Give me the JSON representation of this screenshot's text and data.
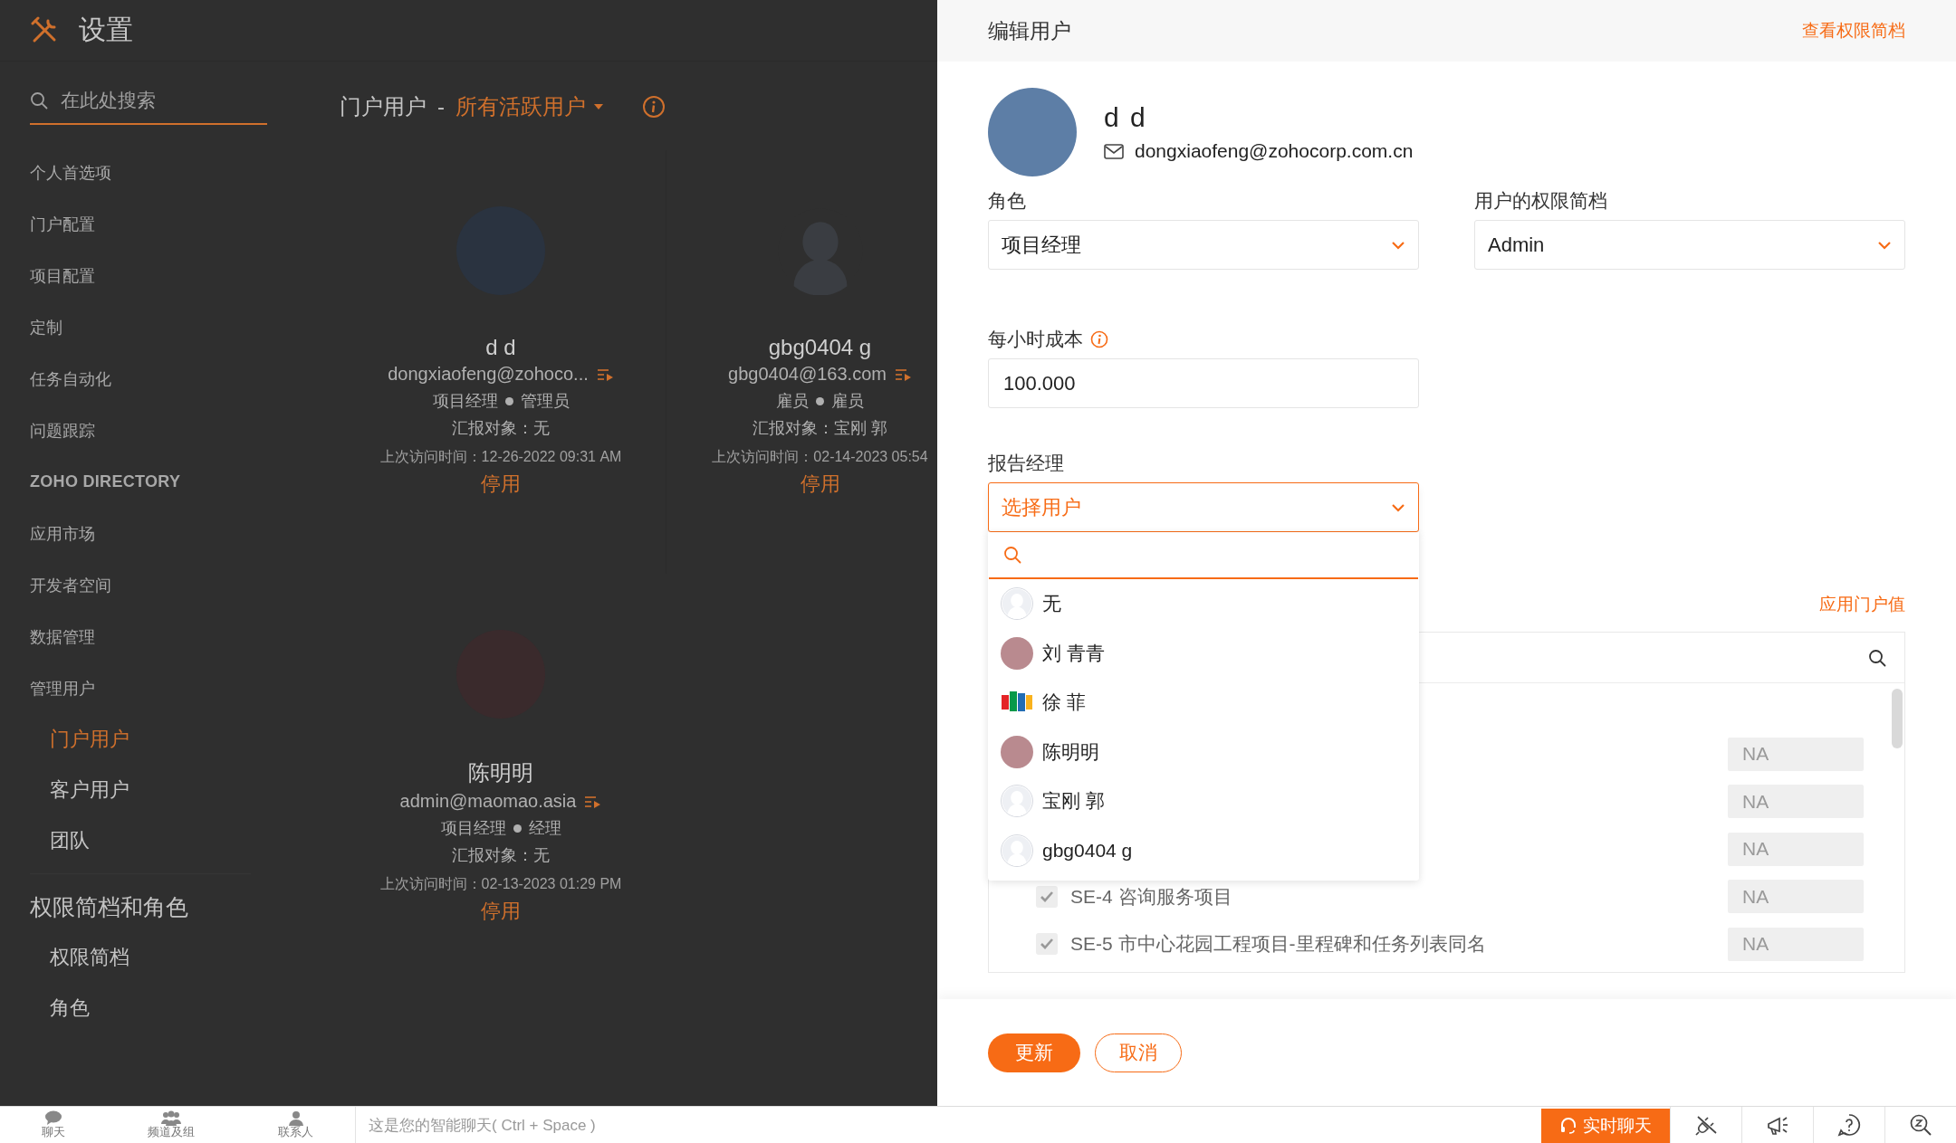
{
  "settings": {
    "title": "设置",
    "search": {
      "placeholder": "在此处搜索"
    },
    "sidebar": {
      "items": [
        {
          "label": "个人首选项",
          "kind": "plain",
          "selected": false
        },
        {
          "label": "门户配置",
          "kind": "plain",
          "selected": false
        },
        {
          "label": "项目配置",
          "kind": "plain",
          "selected": false
        },
        {
          "label": "定制",
          "kind": "plain",
          "selected": false
        },
        {
          "label": "任务自动化",
          "kind": "plain",
          "selected": false
        },
        {
          "label": "问题跟踪",
          "kind": "plain",
          "selected": false
        },
        {
          "label": "ZOHO DIRECTORY",
          "kind": "brand",
          "selected": false
        },
        {
          "label": "应用市场",
          "kind": "plain",
          "selected": false
        },
        {
          "label": "开发者空间",
          "kind": "plain",
          "selected": false
        },
        {
          "label": "数据管理",
          "kind": "plain",
          "selected": false
        },
        {
          "label": "管理用户",
          "kind": "plain",
          "selected": false,
          "children": [
            {
              "label": "门户用户",
              "selected": true
            },
            {
              "label": "客户用户",
              "selected": false
            },
            {
              "label": "团队",
              "selected": false
            }
          ]
        }
      ],
      "section": {
        "title": "权限简档和角色",
        "items": [
          {
            "label": "权限简档",
            "selected": false
          },
          {
            "label": "角色",
            "selected": false
          }
        ]
      }
    },
    "page": {
      "title": "门户用户",
      "separator": "-",
      "filter": "所有活跃用户",
      "cards": [
        {
          "name": "d d",
          "kind": "photo",
          "email": "dongxiaofeng@zohoco...",
          "role": "项目经理",
          "profile": "管理员",
          "reports_to": "汇报对象：无",
          "last_visit": "上次访问时间：12-26-2022 09:31 AM",
          "action": "停用"
        },
        {
          "name": "gbg0404 g",
          "kind": "default",
          "email": "gbg0404@163.com",
          "role": "雇员",
          "profile": "雇员",
          "reports_to": "汇报对象：宝刚 郭",
          "last_visit": "上次访问时间：02-14-2023 05:54",
          "action": "停用"
        },
        {
          "name": "陈明明",
          "kind": "photo",
          "email": "admin@maomao.asia",
          "role": "项目经理",
          "profile": "经理",
          "reports_to": "汇报对象：无",
          "last_visit": "上次访问时间：02-13-2023 01:29 PM",
          "action": "停用"
        }
      ]
    }
  },
  "edit_panel": {
    "title": "编辑用户",
    "link": "查看权限简档",
    "user": {
      "name": "d d",
      "email": "dongxiaofeng@zohocorp.com.cn"
    },
    "role": {
      "label": "角色",
      "value": "项目经理"
    },
    "profile": {
      "label": "用户的权限简档",
      "value": "Admin"
    },
    "hourly_cost": {
      "label": "每小时成本",
      "value": "100.000"
    },
    "reporting_manager": {
      "label": "报告经理",
      "value": "选择用户",
      "expanded": true,
      "options": [
        {
          "label": "无",
          "kind": "default"
        },
        {
          "label": "刘 青青",
          "kind": "photo"
        },
        {
          "label": "徐 菲",
          "kind": "logo"
        },
        {
          "label": "陈明明",
          "kind": "photo"
        },
        {
          "label": "宝刚 郭",
          "kind": "default"
        },
        {
          "label": "gbg0404 g",
          "kind": "default"
        }
      ]
    },
    "apply_link": "应用门户值",
    "projects": [
      {
        "rate": "NA"
      },
      {
        "rate": "NA"
      },
      {
        "rate": "NA"
      },
      {
        "label": "SE-4 咨询服务项目",
        "checked": true,
        "rate": "NA"
      },
      {
        "label": "SE-5 市中心花园工程项目-里程碑和任务列表同名",
        "checked": true,
        "rate": "NA"
      }
    ],
    "buttons": [
      {
        "label": "更新",
        "kind": "primary"
      },
      {
        "label": "取消",
        "kind": "secondary"
      }
    ]
  },
  "bottom_bar": {
    "tabs": [
      {
        "label": "聊天"
      },
      {
        "label": "频道及组"
      },
      {
        "label": "联系人"
      }
    ],
    "hint": "这是您的智能聊天( Ctrl + Space )",
    "live_chat": "实时聊天"
  }
}
